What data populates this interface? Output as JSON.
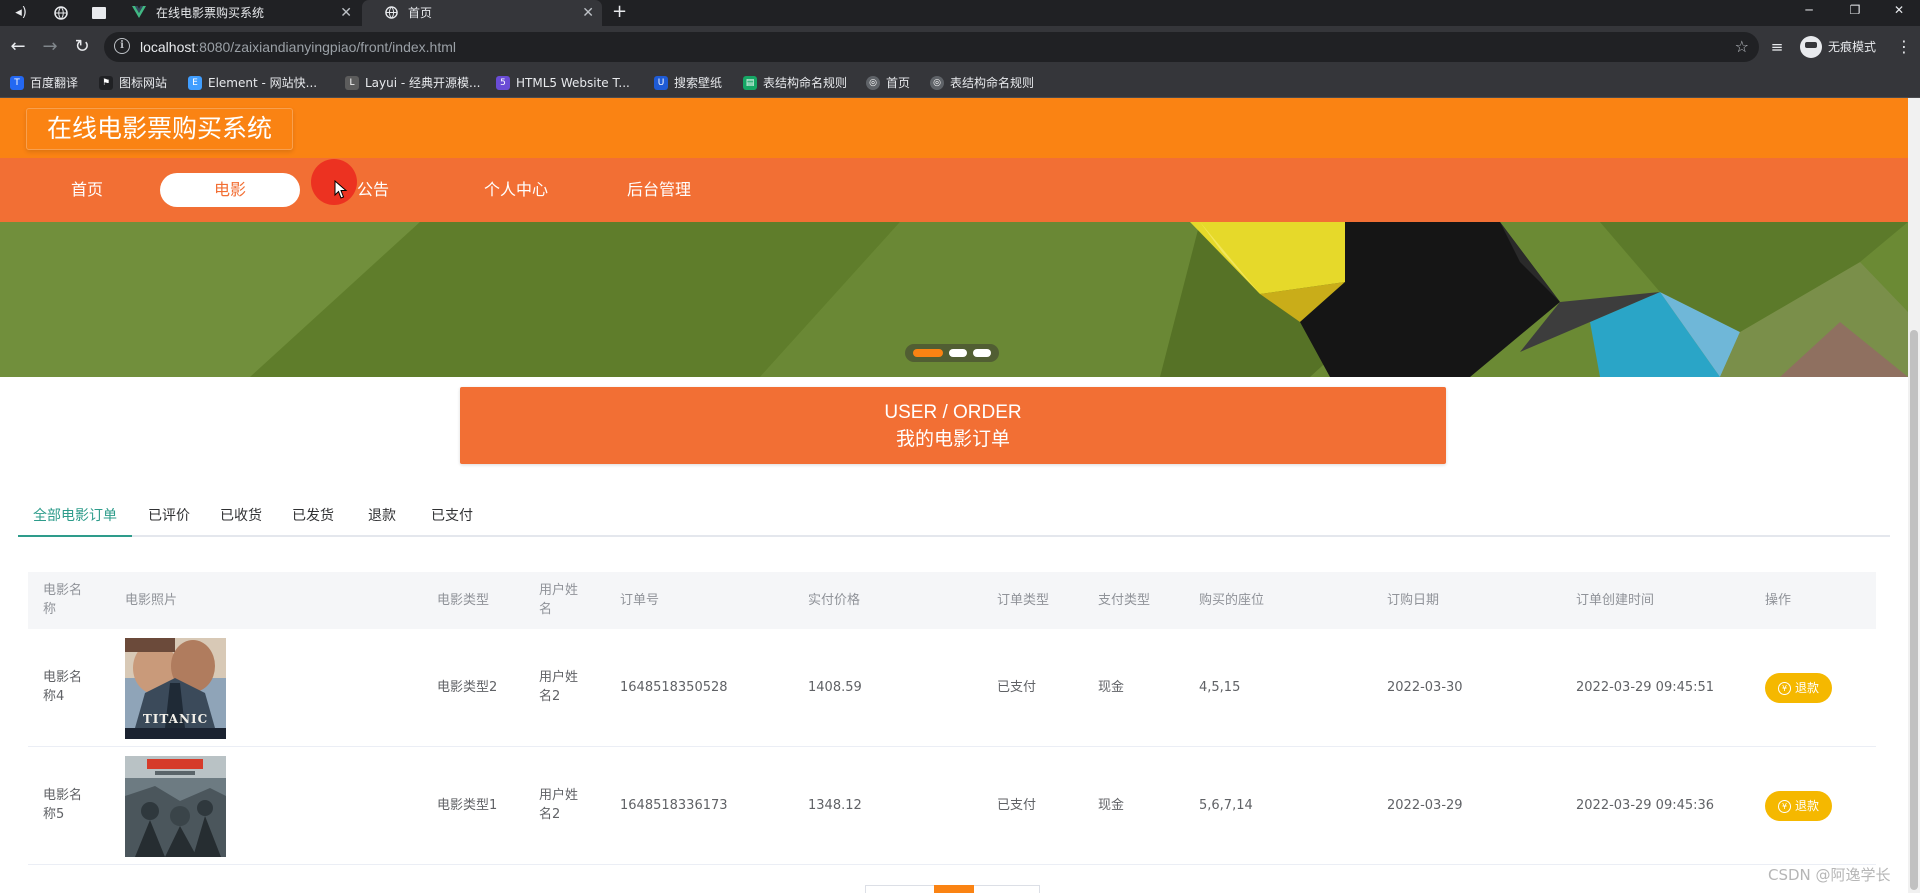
{
  "browser": {
    "tabs": [
      {
        "title": "在线电影票购买系统",
        "active": false
      },
      {
        "title": "首页",
        "active": true
      }
    ],
    "url_host": "localhost",
    "url_path": ":8080/zaixiandianyingpiao/front/index.html",
    "incognito_label": "无痕模式",
    "bookmarks": [
      {
        "label": "百度翻译",
        "icon": "translate-icon",
        "color": "#2468f2"
      },
      {
        "label": "图标网站",
        "icon": "flag-icon",
        "color": "#202124"
      },
      {
        "label": "Element - 网站快...",
        "icon": "element-icon",
        "color": "#409eff"
      },
      {
        "label": "Layui - 经典开源模...",
        "icon": "layui-icon",
        "color": "#5c5c5c"
      },
      {
        "label": "HTML5 Website T...",
        "icon": "html5-icon",
        "color": "#6a4cd6"
      },
      {
        "label": "搜索壁纸",
        "icon": "wallpaper-icon",
        "color": "#1e5bd6"
      },
      {
        "label": "表结构命名规则",
        "icon": "sheet-icon",
        "color": "#16a765"
      },
      {
        "label": "首页",
        "icon": "globe-icon",
        "color": "#5f6368"
      },
      {
        "label": "表结构命名规则",
        "icon": "globe-icon",
        "color": "#5f6368"
      }
    ]
  },
  "site": {
    "title": "在线电影票购买系统",
    "nav": [
      {
        "label": "首页",
        "active": false
      },
      {
        "label": "电影",
        "active": true
      },
      {
        "label": "公告",
        "active": false
      },
      {
        "label": "个人中心",
        "active": false
      },
      {
        "label": "后台管理",
        "active": false
      }
    ],
    "colors": {
      "header": "#fa8313",
      "nav": "#f26f34",
      "tab_active": "#2e9c8b",
      "refund": "#f5b800"
    }
  },
  "carousel": {
    "slide_count": 3,
    "active_index": 0
  },
  "order_banner": {
    "en": "USER / ORDER",
    "cn": "我的电影订单"
  },
  "order_tabs": [
    {
      "label": "全部电影订单",
      "active": true
    },
    {
      "label": "已评价",
      "active": false
    },
    {
      "label": "已收货",
      "active": false
    },
    {
      "label": "已发货",
      "active": false
    },
    {
      "label": "退款",
      "active": false
    },
    {
      "label": "已支付",
      "active": false
    }
  ],
  "table": {
    "headers": {
      "name": "电影名\n称",
      "photo": "电影照片",
      "type": "电影类型",
      "user": "用户姓\n名",
      "order_no": "订单号",
      "price": "实付价格",
      "order_type": "订单类型",
      "pay_type": "支付类型",
      "seats": "购买的座位",
      "date": "订购日期",
      "created": "订单创建时间",
      "action": "操作"
    },
    "rows": [
      {
        "name": "电影名\n称4",
        "poster_text": "TITANIC",
        "type": "电影类型2",
        "user": "用户姓\n名2",
        "order_no": "1648518350528",
        "price": "1408.59",
        "order_type": "已支付",
        "pay_type": "现金",
        "seats": "4,5,15",
        "date": "2022-03-30",
        "created": "2022-03-29 09:45:51",
        "action": "退款"
      },
      {
        "name": "电影名\n称5",
        "poster_text": "",
        "type": "电影类型1",
        "user": "用户姓\n名2",
        "order_no": "1648518336173",
        "price": "1348.12",
        "order_type": "已支付",
        "pay_type": "现金",
        "seats": "5,6,7,14",
        "date": "2022-03-29",
        "created": "2022-03-29 09:45:36",
        "action": "退款"
      }
    ]
  },
  "watermark": "CSDN @阿逸学长"
}
